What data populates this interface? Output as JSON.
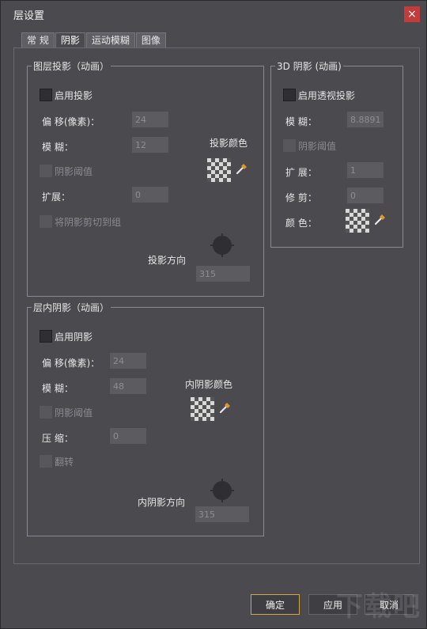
{
  "dialog": {
    "title": "层设置",
    "close_glyph": "×"
  },
  "tabs": [
    "常 规",
    "阴影",
    "运动模糊",
    "图像"
  ],
  "drop_shadow": {
    "title": "图层投影（动画）",
    "enable_label": "启用投影",
    "offset_label": "偏 移(像素)：",
    "offset_value": "24",
    "blur_label": "模 糊：",
    "blur_value": "12",
    "threshold_label": "阴影阈值",
    "expand_label": "扩展：",
    "expand_value": "0",
    "clip_label": "将阴影剪切到组",
    "color_label": "投影颜色",
    "direction_label": "投影方向",
    "direction_value": "315"
  },
  "shadow_3d": {
    "title": "3D 阴影 (动画)",
    "enable_label": "启用透视投影",
    "blur_label": "模 糊：",
    "blur_value": "8.8891",
    "threshold_label": "阴影阈值",
    "expand_label": "扩 展：",
    "expand_value": "1",
    "trim_label": "修 剪：",
    "trim_value": "0",
    "color_label": "颜 色："
  },
  "inner_shadow": {
    "title": "层内阴影（动画）",
    "enable_label": "启用阴影",
    "offset_label": "偏 移(像素)：",
    "offset_value": "24",
    "blur_label": "模 糊：",
    "blur_value": "48",
    "threshold_label": "阴影阈值",
    "compress_label": "压 缩：",
    "compress_value": "0",
    "flip_label": "翻转",
    "color_label": "内阴影颜色",
    "direction_label": "内阴影方向",
    "direction_value": "315"
  },
  "buttons": {
    "ok": "确定",
    "apply": "应用",
    "cancel": "取消"
  },
  "watermark": "下载吧"
}
